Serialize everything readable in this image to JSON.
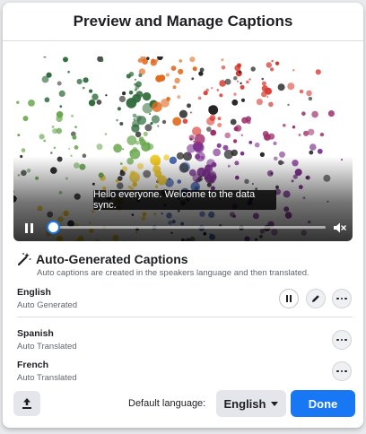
{
  "dialog": {
    "title": "Preview and Manage Captions"
  },
  "video": {
    "caption_text": "Hello everyone. Welcome to the data sync.",
    "progress": 0.02,
    "accent_color": "#1877f2"
  },
  "auto_captions": {
    "icon": "magic-wand-icon",
    "title": "Auto-Generated Captions",
    "description": "Auto captions are created in the speakers language and then translated."
  },
  "languages": [
    {
      "name": "English",
      "status": "Auto Generated",
      "actions": [
        "pause-icon",
        "pencil-icon",
        "more-icon"
      ]
    },
    {
      "name": "Spanish",
      "status": "Auto Translated",
      "actions": [
        "more-icon"
      ]
    },
    {
      "name": "French",
      "status": "Auto Translated",
      "actions": [
        "more-icon"
      ]
    }
  ],
  "footer": {
    "upload_icon": "upload-icon",
    "default_language_label": "Default language:",
    "default_language_value": "English",
    "done_label": "Done",
    "primary_color": "#1877f2"
  }
}
